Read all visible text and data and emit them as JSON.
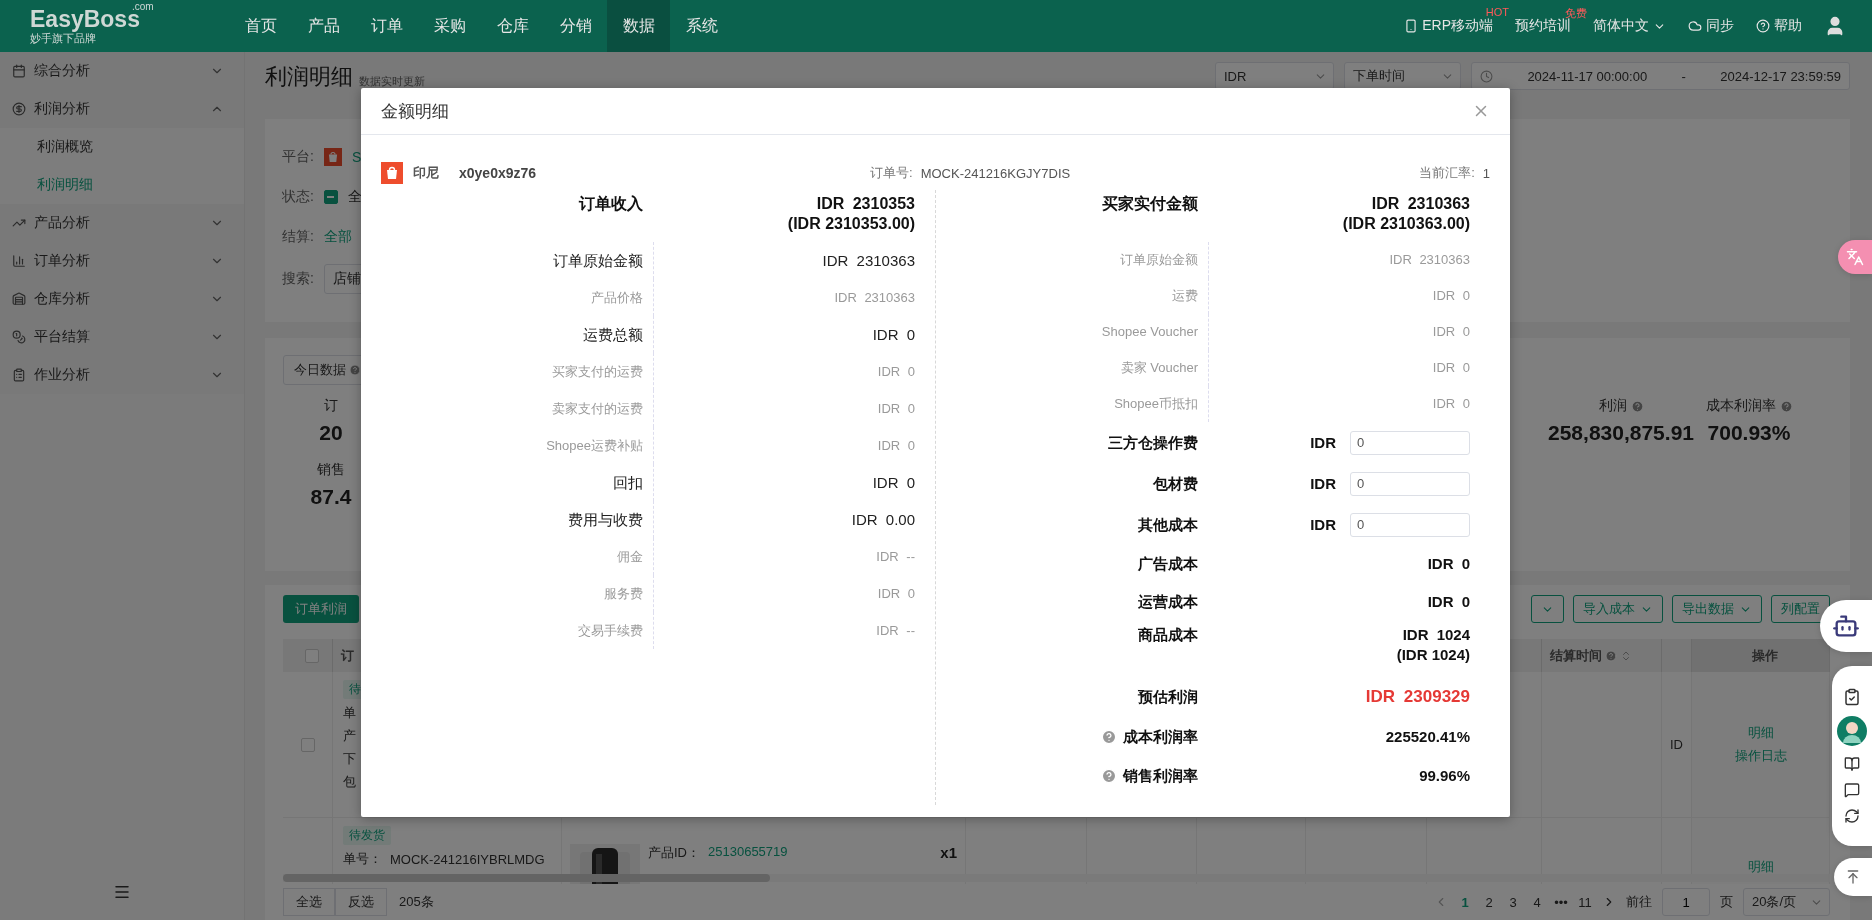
{
  "top_nav": {
    "logo": "EasyBoss",
    "logo_domain": ".com",
    "tagline": "妙手旗下品牌",
    "menu": [
      {
        "label": "首页",
        "selected": false
      },
      {
        "label": "产品",
        "selected": false
      },
      {
        "label": "订单",
        "selected": false
      },
      {
        "label": "采购",
        "selected": false
      },
      {
        "label": "仓库",
        "selected": false
      },
      {
        "label": "分销",
        "selected": false
      },
      {
        "label": "数据",
        "selected": true
      },
      {
        "label": "系统",
        "selected": false
      }
    ],
    "tools": [
      {
        "kind": "mobile",
        "label": "ERP移动端",
        "badge": "HOT"
      },
      {
        "kind": "plain",
        "label": "预约培训",
        "badge": "免费"
      },
      {
        "kind": "language",
        "label": "简体中文"
      },
      {
        "kind": "sync",
        "label": "同步"
      },
      {
        "kind": "help",
        "label": "帮助"
      },
      {
        "kind": "user"
      }
    ]
  },
  "sidebar": {
    "items": [
      {
        "label": "综合分析",
        "expanded": false
      },
      {
        "label": "利润分析",
        "expanded": true,
        "children": [
          {
            "label": "利润概览",
            "selected": false
          },
          {
            "label": "利润明细",
            "selected": true
          }
        ]
      },
      {
        "label": "产品分析",
        "expanded": false
      },
      {
        "label": "订单分析",
        "expanded": false
      },
      {
        "label": "仓库分析",
        "expanded": false
      },
      {
        "label": "平台结算",
        "expanded": false
      },
      {
        "label": "作业分析",
        "expanded": false
      }
    ]
  },
  "header": {
    "title": "利润明细",
    "subtitle": "数据实时更新",
    "currency": "IDR",
    "time_type": "下单时间",
    "date_start": "2024-11-17 00:00:00",
    "date_separator": "-",
    "date_end": "2024-12-17 23:59:59"
  },
  "filters": [
    {
      "kind": "platform",
      "label": "平台:",
      "value": "S"
    },
    {
      "kind": "checkbox",
      "label": "状态:",
      "value": "全",
      "indeterminate": true
    },
    {
      "kind": "link",
      "label": "结算:",
      "value": "全部"
    },
    {
      "kind": "select",
      "label": "搜索:",
      "value": "店铺"
    }
  ],
  "stats": {
    "today_button": "今日数据",
    "cells": [
      {
        "label": "订",
        "value": "20",
        "help": false
      },
      {
        "label": "利润",
        "value": "258,830,875.91",
        "help": true
      },
      {
        "label": "成本利润率",
        "value": "700.93%",
        "help": true
      },
      {
        "label": "销售",
        "value": "87.4",
        "help": false
      }
    ]
  },
  "table": {
    "tab_button": "订单利润",
    "actions": [
      {
        "kind": "dropdown"
      },
      {
        "kind": "dropdown",
        "label": "导入成本"
      },
      {
        "kind": "dropdown",
        "label": "导出数据"
      },
      {
        "kind": "plain",
        "label": "列配置"
      }
    ],
    "header": {
      "checked": false,
      "order": "订",
      "settle_time": "结算时间",
      "actions": "操作"
    },
    "rows": [
      {
        "checked": false,
        "status": "待",
        "lines": [
          "单",
          "产",
          "下",
          "包"
        ],
        "cut_text": "ID",
        "links": [
          "明细",
          "操作日志"
        ]
      },
      {
        "status": "待发货",
        "order_label": "单号：",
        "order_no": "MOCK-241216IYBRLMDG",
        "product_label": "产品ID：",
        "product_id": "25130655719",
        "quantity": "x1",
        "links": [
          "明细"
        ]
      }
    ]
  },
  "footer": {
    "select_all": "全选",
    "invert": "反选",
    "count": "205条",
    "pages": [
      {
        "label": "1",
        "selected": true
      },
      {
        "label": "2",
        "selected": false
      },
      {
        "label": "3",
        "selected": false
      },
      {
        "label": "4",
        "selected": false
      },
      {
        "label": "•••",
        "selected": false
      },
      {
        "label": "11",
        "selected": false
      }
    ],
    "goto_label": "前往",
    "goto_value": "1",
    "page_unit": "页",
    "page_size": "20条/页"
  },
  "modal": {
    "title": "金额明细",
    "region": "印尼",
    "shop": "x0ye0x9z76",
    "order_label": "订单号:",
    "order_no": "MOCK-241216KGJY7DIS",
    "rate_label": "当前汇率:",
    "rate": "1",
    "income": {
      "label": "订单收入",
      "value": "IDR 2310353",
      "note": "(IDR 2310353.00)",
      "items": [
        {
          "kind": "main",
          "label": "订单原始金额",
          "value": "IDR 2310363"
        },
        {
          "kind": "sub",
          "label": "产品价格",
          "value": "IDR 2310363"
        },
        {
          "kind": "main",
          "label": "运费总额",
          "value": "IDR 0"
        },
        {
          "kind": "sub",
          "label": "买家支付的运费",
          "value": "IDR 0"
        },
        {
          "kind": "sub",
          "label": "卖家支付的运费",
          "value": "IDR 0"
        },
        {
          "kind": "sub",
          "label": "Shopee运费补贴",
          "value": "IDR 0"
        },
        {
          "kind": "main",
          "label": "回扣",
          "value": "IDR 0"
        },
        {
          "kind": "main",
          "label": "费用与收费",
          "value": "IDR 0.00"
        },
        {
          "kind": "sub",
          "label": "佣金",
          "value": "IDR --"
        },
        {
          "kind": "sub",
          "label": "服务费",
          "value": "IDR 0"
        },
        {
          "kind": "sub",
          "label": "交易手续费",
          "value": "IDR --"
        }
      ]
    },
    "paid": {
      "label": "买家实付金额",
      "value": "IDR 2310363",
      "note": "(IDR 2310363.00)",
      "items": [
        {
          "kind": "sub",
          "label": "订单原始金额",
          "value": "IDR 2310363"
        },
        {
          "kind": "sub",
          "label": "运费",
          "value": "IDR 0"
        },
        {
          "kind": "sub",
          "label": "Shopee Voucher",
          "value": "IDR 0"
        },
        {
          "kind": "sub",
          "label": "卖家 Voucher",
          "value": "IDR 0"
        },
        {
          "kind": "sub",
          "label": "Shopee币抵扣",
          "value": "IDR 0"
        }
      ]
    },
    "costs": [
      {
        "kind": "input",
        "label": "三方仓操作费",
        "currency": "IDR",
        "value": "0"
      },
      {
        "kind": "input",
        "label": "包材费",
        "currency": "IDR",
        "value": "0"
      },
      {
        "kind": "input",
        "label": "其他成本",
        "currency": "IDR",
        "value": "0"
      },
      {
        "kind": "bold",
        "label": "广告成本",
        "value": "IDR 0"
      },
      {
        "kind": "bold",
        "label": "运营成本",
        "value": "IDR 0"
      },
      {
        "kind": "bold",
        "label": "商品成本",
        "value": "IDR 1024",
        "note": "(IDR 1024)"
      },
      {
        "kind": "profit",
        "label": "预估利润",
        "value": "IDR 2309329"
      },
      {
        "kind": "rate",
        "label": "成本利润率",
        "value": "225520.41%"
      },
      {
        "kind": "rate",
        "label": "销售利润率",
        "value": "99.96%"
      }
    ]
  }
}
